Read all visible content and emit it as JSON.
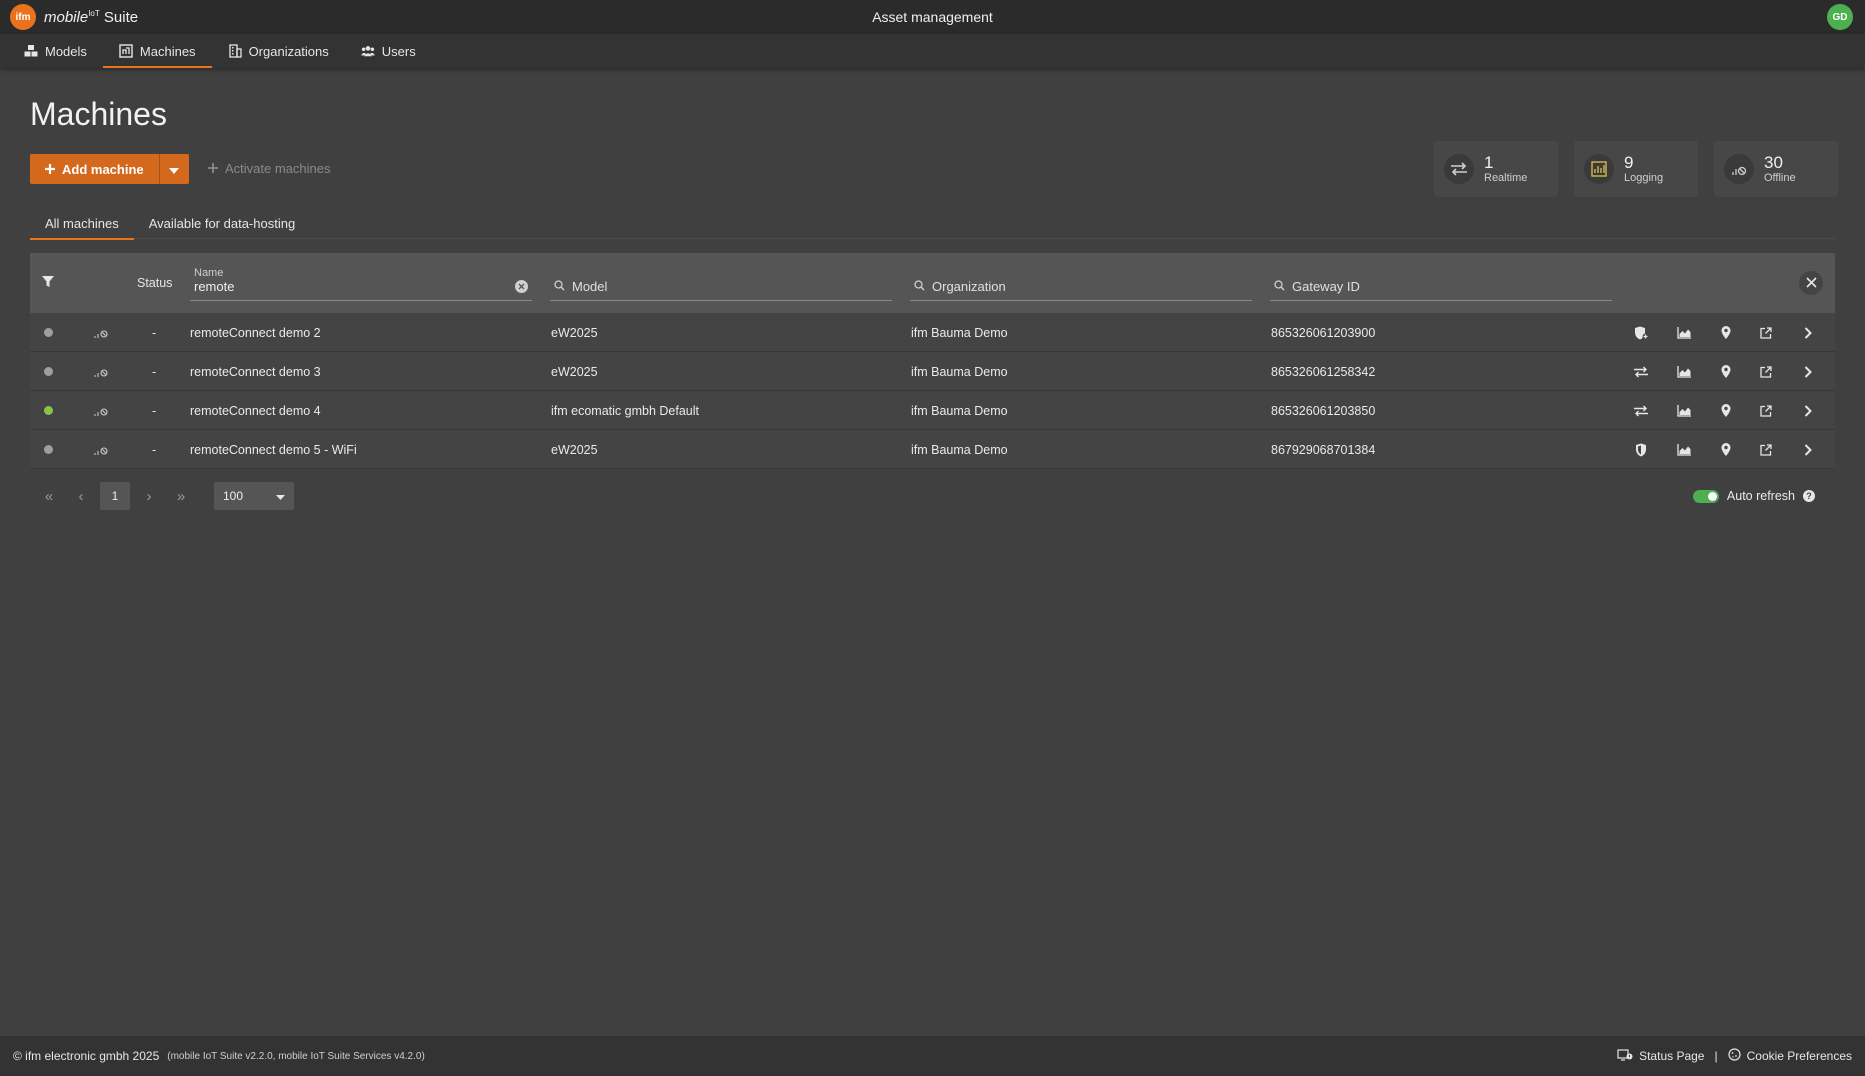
{
  "app": {
    "brand_italic": "mobile",
    "brand_sup": "IoT",
    "brand_rest": "Suite",
    "logo_text": "ifm",
    "title": "Asset management",
    "user_initials": "GD"
  },
  "nav": {
    "items": [
      {
        "label": "Models",
        "icon": "cubes-icon"
      },
      {
        "label": "Machines",
        "icon": "machine-icon",
        "active": true
      },
      {
        "label": "Organizations",
        "icon": "building-icon"
      },
      {
        "label": "Users",
        "icon": "users-icon"
      }
    ]
  },
  "page": {
    "title": "Machines",
    "add_label": "Add machine",
    "activate_label": "Activate machines"
  },
  "stats": [
    {
      "value": "1",
      "label": "Realtime",
      "icon": "arrows-exchange-icon"
    },
    {
      "value": "9",
      "label": "Logging",
      "icon": "log-grid-icon"
    },
    {
      "value": "30",
      "label": "Offline",
      "icon": "signal-off-icon"
    }
  ],
  "tabs": [
    {
      "label": "All machines",
      "active": true
    },
    {
      "label": "Available for data-hosting"
    }
  ],
  "table": {
    "status_header": "Status",
    "name_label": "Name",
    "name_value": "remote",
    "model_placeholder": "Model",
    "organization_placeholder": "Organization",
    "gateway_placeholder": "Gateway ID",
    "rows": [
      {
        "online": false,
        "status": "-",
        "name": "remoteConnect demo 2",
        "model": "eW2025",
        "organization": "ifm Bauma Demo",
        "gateway": "865326061203900",
        "first_icon": "shield-plus-icon"
      },
      {
        "online": false,
        "status": "-",
        "name": "remoteConnect demo 3",
        "model": "eW2025",
        "organization": "ifm Bauma Demo",
        "gateway": "865326061258342",
        "first_icon": "arrows-exchange-icon"
      },
      {
        "online": true,
        "status": "-",
        "name": "remoteConnect demo 4",
        "model": "ifm ecomatic gmbh Default",
        "organization": "ifm Bauma Demo",
        "gateway": "865326061203850",
        "first_icon": "arrows-exchange-icon"
      },
      {
        "online": false,
        "status": "-",
        "name": "remoteConnect demo 5 - WiFi",
        "model": "eW2025",
        "organization": "ifm Bauma Demo",
        "gateway": "867929068701384",
        "first_icon": "shield-icon"
      }
    ]
  },
  "pager": {
    "current_page": "1",
    "page_size": "100"
  },
  "auto_refresh": {
    "label": "Auto refresh",
    "enabled": true
  },
  "footer": {
    "copyright": "© ifm electronic gmbh 2025",
    "version": "(mobile IoT Suite v2.2.0, mobile IoT Suite Services v4.2.0)",
    "status_page": "Status Page",
    "separator": "|",
    "cookie_prefs": "Cookie Preferences"
  },
  "colors": {
    "accent": "#e8731c",
    "button": "#d4691d",
    "online": "#8bc34a",
    "offline": "#9e9e9e",
    "toggle_on": "#4caf50"
  }
}
